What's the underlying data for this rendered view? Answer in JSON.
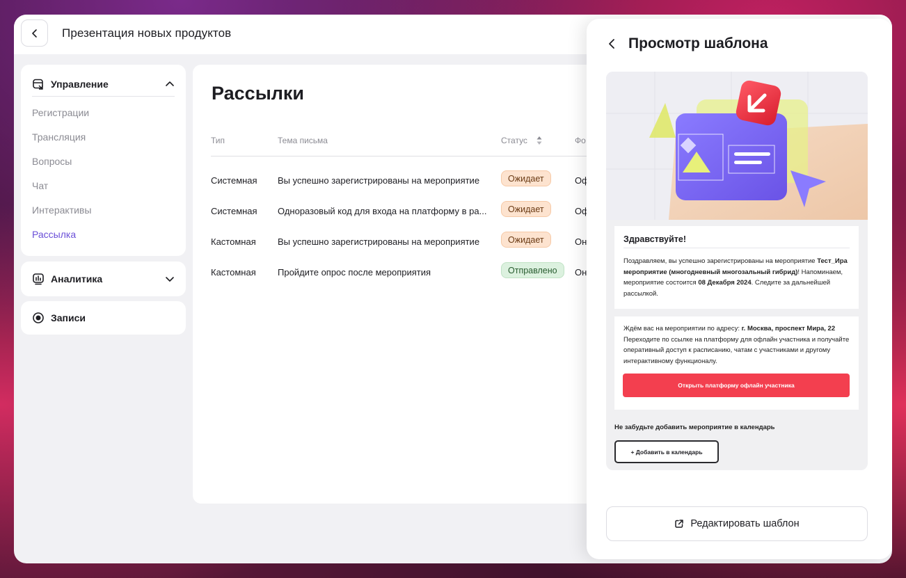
{
  "header": {
    "event_title": "Презентация новых продуктов"
  },
  "sidebar": {
    "management": {
      "label": "Управление",
      "items": [
        {
          "label": "Регистрации"
        },
        {
          "label": "Трансляция"
        },
        {
          "label": "Вопросы"
        },
        {
          "label": "Чат"
        },
        {
          "label": "Интерактивы"
        },
        {
          "label": "Рассылка",
          "active": true
        }
      ]
    },
    "analytics": {
      "label": "Аналитика"
    },
    "records": {
      "label": "Записи"
    }
  },
  "main": {
    "title": "Рассылки",
    "columns": {
      "type": "Тип",
      "subject": "Тема письма",
      "status": "Статус",
      "format": "Фо"
    },
    "rows": [
      {
        "type": "Системная",
        "subject": "Вы успешно зарегистрированы на мероприятие",
        "status": "Ожидает",
        "status_kind": "wait",
        "format": "Оф"
      },
      {
        "type": "Системная",
        "subject": "Одноразовый код для входа на платформу в ра...",
        "status": "Ожидает",
        "status_kind": "wait",
        "format": "Оф"
      },
      {
        "type": "Кастомная",
        "subject": "Вы успешно зарегистрированы на мероприятие",
        "status": "Ожидает",
        "status_kind": "wait",
        "format": "Он"
      },
      {
        "type": "Кастомная",
        "subject": "Пройдите опрос после мероприятия",
        "status": "Отправлено",
        "status_kind": "sent",
        "format": "Он"
      }
    ]
  },
  "panel": {
    "title": "Просмотр шаблона",
    "email": {
      "greeting": "Здравствуйте!",
      "p1_a": "Поздравляем, вы успешно зарегистрированы на мероприятие ",
      "p1_event": "Тест_Ира мероприятие (многодневный многозальный гибрид)",
      "p1_b": "! Напоминаем, мероприятие состоится ",
      "p1_date": "08 Декабря 2024",
      "p1_c": ". Следите за дальнейшей рассылкой.",
      "p2_a": "Ждём вас на мероприятии по адресу: ",
      "p2_address": "г. Москва, проспект Мира, 22",
      "p2_b": "Переходите по ссылке на платформу для офлайн участника и получайте оперативный доступ к расписанию, чатам с участниками и другому интерактивному функционалу.",
      "open_button": "Открыть платформу офлайн участника",
      "calendar_note": "Не забудьте добавить мероприятие в календарь",
      "calendar_button": "+ Добавить в календарь"
    },
    "edit_button": "Редактировать шаблон"
  },
  "colors": {
    "accent": "#6a4fd8",
    "cta_red": "#f33f4f",
    "status_wait_bg": "#fde3cf",
    "status_sent_bg": "#dcf1df"
  }
}
